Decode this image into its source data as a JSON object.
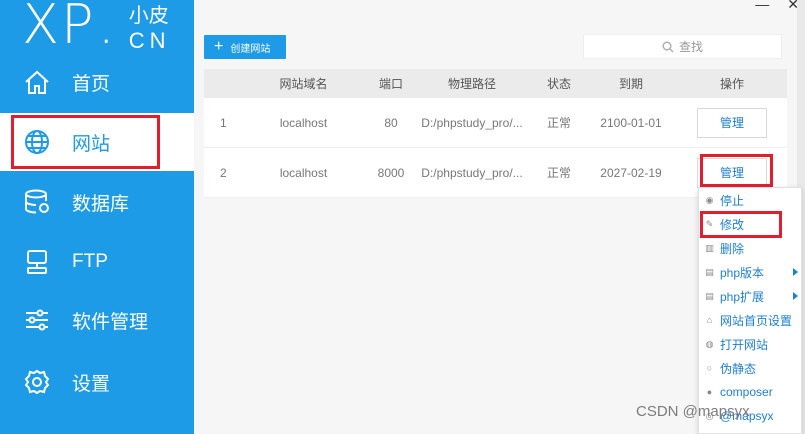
{
  "logo": {
    "brand": "XP",
    "dot": ".",
    "cn_top": "小皮",
    "cn_bottom": "CN"
  },
  "sidebar": {
    "items": [
      {
        "label": "首页",
        "icon": "home-icon",
        "active": false
      },
      {
        "label": "网站",
        "icon": "globe-icon",
        "active": true
      },
      {
        "label": "数据库",
        "icon": "database-icon",
        "active": false
      },
      {
        "label": "FTP",
        "icon": "ftp-server-icon",
        "active": false
      },
      {
        "label": "软件管理",
        "icon": "sliders-icon",
        "active": false
      },
      {
        "label": "设置",
        "icon": "gear-icon",
        "active": false
      }
    ]
  },
  "window": {
    "minimize": "—",
    "close": "✕"
  },
  "toolbar": {
    "create_label": "创建网站",
    "create_icon": "+",
    "search_placeholder": "查找"
  },
  "table": {
    "headers": {
      "domain": "网站域名",
      "port": "端口",
      "path": "物理路径",
      "status": "状态",
      "expire": "到期",
      "op": "操作"
    },
    "rows": [
      {
        "idx": "1",
        "domain": "localhost",
        "port": "80",
        "path": "D:/phpstudy_pro/...",
        "status": "正常",
        "expire": "2100-01-01",
        "op": "管理"
      },
      {
        "idx": "2",
        "domain": "localhost",
        "port": "8000",
        "path": "D:/phpstudy_pro/...",
        "status": "正常",
        "expire": "2027-02-19",
        "op": "管理"
      }
    ]
  },
  "context_menu": {
    "items": [
      {
        "label": "停止",
        "icon": "stop-icon",
        "submenu": false
      },
      {
        "label": "修改",
        "icon": "edit-icon",
        "submenu": false
      },
      {
        "label": "删除",
        "icon": "trash-icon",
        "submenu": false
      },
      {
        "label": "php版本",
        "icon": "php-version-icon",
        "submenu": true
      },
      {
        "label": "php扩展",
        "icon": "php-extension-icon",
        "submenu": true
      },
      {
        "label": "网站首页设置",
        "icon": "homepage-icon",
        "submenu": false
      },
      {
        "label": "打开网站",
        "icon": "open-site-icon",
        "submenu": false
      },
      {
        "label": "伪静态",
        "icon": "rewrite-icon",
        "submenu": false
      },
      {
        "label": "composer",
        "icon": "composer-icon",
        "submenu": false
      },
      {
        "label": "@mapsyx",
        "icon": "more-icon",
        "submenu": false
      }
    ]
  },
  "watermark": "CSDN @mapsyx",
  "colors": {
    "accent": "#1e9be6",
    "highlight": "#e01e2e",
    "link": "#1e7fd0"
  }
}
